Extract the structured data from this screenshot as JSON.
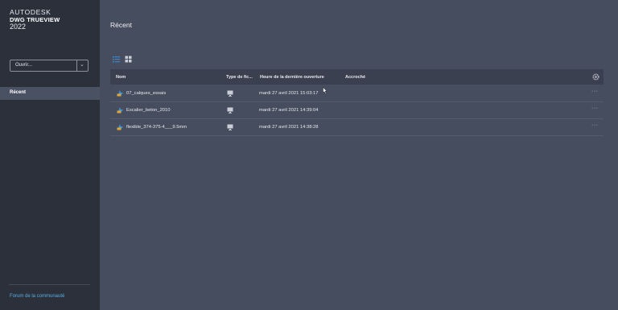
{
  "brand": {
    "company": "AUTODESK",
    "product": "DWG TRUEVIEW",
    "year": "2022"
  },
  "sidebar": {
    "open_button": {
      "label": "Ouvrir...",
      "caret_icon": "chevron-down-icon"
    },
    "nav_items": [
      {
        "label": "Récent",
        "selected": true
      }
    ],
    "community_link": "Forum de la communauté"
  },
  "main": {
    "title": "Récent",
    "view_toggle": {
      "list_icon": "list-view-icon",
      "grid_icon": "grid-view-icon",
      "active": "list"
    },
    "table": {
      "columns": [
        "Nom",
        "Type de fic...",
        "Heure de la dernière ouverture",
        "Accroché"
      ],
      "settings_icon": "gear-icon",
      "rows": [
        {
          "name": "07_calques_essais",
          "type_icon": "monitor-icon",
          "last_opened": "mardi 27 avril 2021 15:03:17",
          "pinned": "",
          "more_icon": "ellipsis-icon"
        },
        {
          "name": "Escalier_beton_2010",
          "type_icon": "monitor-icon",
          "last_opened": "mardi 27 avril 2021 14:39:04",
          "pinned": "",
          "more_icon": "ellipsis-icon"
        },
        {
          "name": "flexible_374-375-4___9.5mm",
          "type_icon": "monitor-icon",
          "last_opened": "mardi 27 avril 2021 14:38:28",
          "pinned": "",
          "more_icon": "ellipsis-icon"
        }
      ]
    }
  },
  "colors": {
    "sidebar_bg": "#2b303b",
    "main_bg": "#464d5e",
    "header_bg": "#3a4050",
    "selected_nav_bg": "#4a5163",
    "link_color": "#59b0e3",
    "accent_blue": "#3d8fd8"
  }
}
